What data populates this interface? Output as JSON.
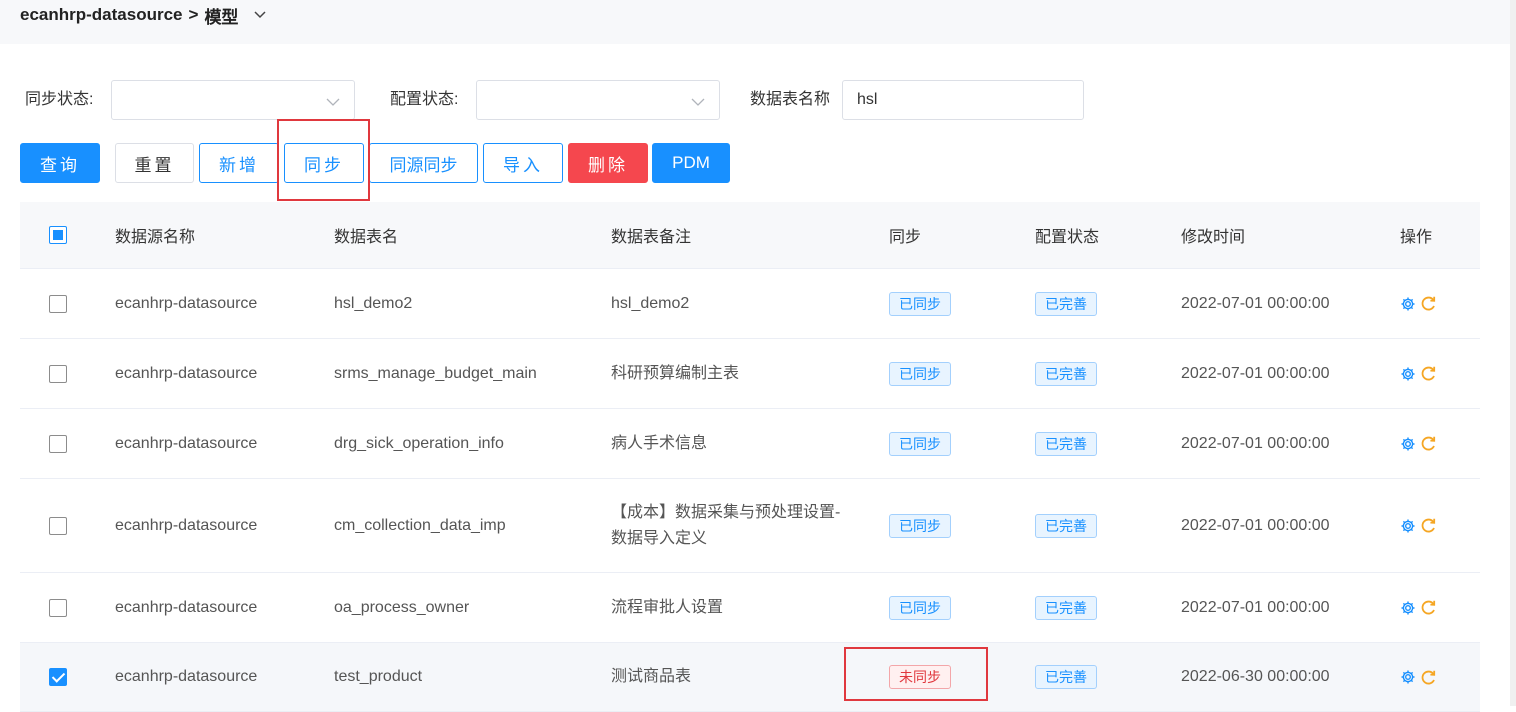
{
  "breadcrumb": {
    "datasource": "ecanhrp-datasource",
    "separator": ">",
    "current": "模型"
  },
  "filters": {
    "sync_status_label": "同步状态:",
    "sync_status_value": "",
    "config_status_label": "配置状态:",
    "config_status_value": "",
    "table_name_label": "数据表名称",
    "table_name_value": "hsl"
  },
  "toolbar": {
    "query": "查询",
    "reset": "重置",
    "add": "新增",
    "sync": "同步",
    "same_source_sync": "同源同步",
    "import": "导入",
    "delete": "删除",
    "pdm": "PDM"
  },
  "table": {
    "columns": [
      "数据源名称",
      "数据表名",
      "数据表备注",
      "同步",
      "配置状态",
      "修改时间",
      "操作"
    ],
    "rows": [
      {
        "datasource": "ecanhrp-datasource",
        "table": "hsl_demo2",
        "remark": "hsl_demo2",
        "sync": "已同步",
        "config": "已完善",
        "time": "2022-07-01 00:00:00",
        "checked": false
      },
      {
        "datasource": "ecanhrp-datasource",
        "table": "srms_manage_budget_main",
        "remark": "科研预算编制主表",
        "sync": "已同步",
        "config": "已完善",
        "time": "2022-07-01 00:00:00",
        "checked": false
      },
      {
        "datasource": "ecanhrp-datasource",
        "table": "drg_sick_operation_info",
        "remark": "病人手术信息",
        "sync": "已同步",
        "config": "已完善",
        "time": "2022-07-01 00:00:00",
        "checked": false
      },
      {
        "datasource": "ecanhrp-datasource",
        "table": "cm_collection_data_imp",
        "remark": "【成本】数据采集与预处理设置-数据导入定义",
        "sync": "已同步",
        "config": "已完善",
        "time": "2022-07-01 00:00:00",
        "checked": false
      },
      {
        "datasource": "ecanhrp-datasource",
        "table": "oa_process_owner",
        "remark": "流程审批人设置",
        "sync": "已同步",
        "config": "已完善",
        "time": "2022-07-01 00:00:00",
        "checked": false
      },
      {
        "datasource": "ecanhrp-datasource",
        "table": "test_product",
        "remark": "测试商品表",
        "sync": "未同步",
        "config": "已完善",
        "time": "2022-06-30 00:00:00",
        "checked": true
      }
    ]
  },
  "icons": {
    "breadcrumb_dropdown": "chevron-down-icon",
    "select_arrow": "chevron-down-icon",
    "settings": "gear-icon",
    "refresh": "refresh-icon"
  },
  "colors": {
    "primary": "#1890ff",
    "danger": "#f5474e",
    "highlight": "#e0383e",
    "refresh_icon": "#f5a623"
  }
}
